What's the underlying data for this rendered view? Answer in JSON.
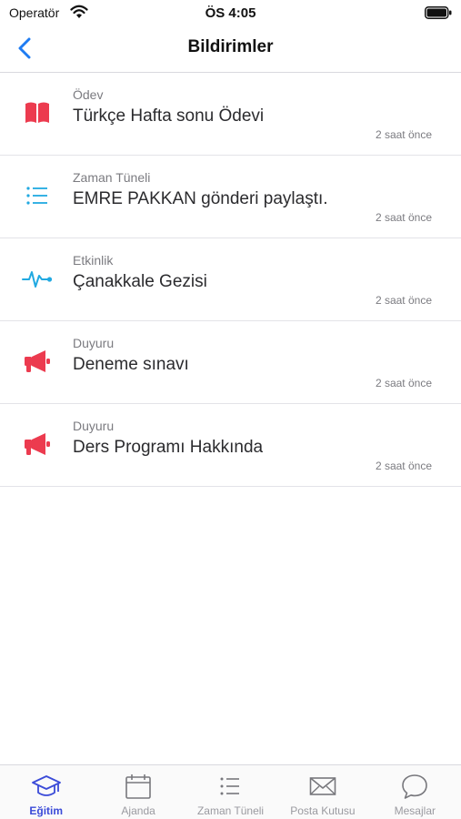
{
  "status_bar": {
    "carrier": "Operatör",
    "time": "ÖS 4:05"
  },
  "header": {
    "title": "Bildirimler"
  },
  "colors": {
    "accent": "#1f7cf2",
    "tab_active": "#3b4bd8",
    "red": "#ec3b4f",
    "cyan": "#21a9e1"
  },
  "notifications": [
    {
      "category": "Ödev",
      "title": "Türkçe Hafta sonu Ödevi",
      "time": "2 saat önce",
      "icon": "book-icon"
    },
    {
      "category": "Zaman Tüneli",
      "title": "EMRE PAKKAN gönderi paylaştı.",
      "time": "2 saat önce",
      "icon": "list-icon"
    },
    {
      "category": "Etkinlik",
      "title": "Çanakkale Gezisi",
      "time": "2 saat önce",
      "icon": "pulse-icon"
    },
    {
      "category": "Duyuru",
      "title": "Deneme sınavı",
      "time": "2 saat önce",
      "icon": "megaphone-icon"
    },
    {
      "category": "Duyuru",
      "title": "Ders Programı Hakkında",
      "time": "2 saat önce",
      "icon": "megaphone-icon"
    }
  ],
  "tabs": [
    {
      "label": "Eğitim",
      "icon": "graduation-cap-icon",
      "active": true
    },
    {
      "label": "Ajanda",
      "icon": "calendar-icon",
      "active": false
    },
    {
      "label": "Zaman Tüneli",
      "icon": "list-icon",
      "active": false
    },
    {
      "label": "Posta Kutusu",
      "icon": "envelope-icon",
      "active": false
    },
    {
      "label": "Mesajlar",
      "icon": "chat-bubble-icon",
      "active": false
    }
  ]
}
